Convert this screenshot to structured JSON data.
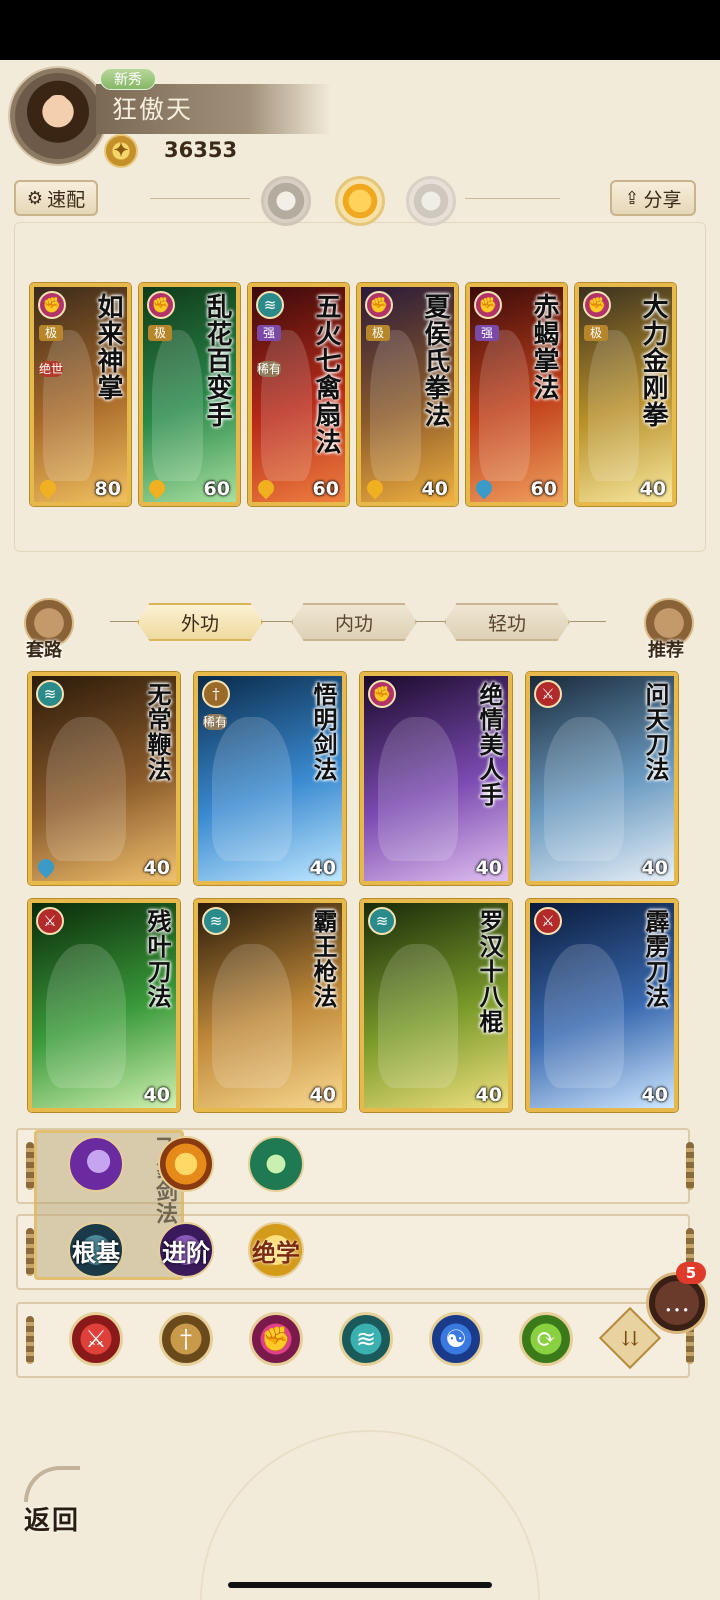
{
  "player": {
    "rank_badge": "新秀",
    "name": "狂傲天",
    "power_icon": "power-medal-icon",
    "power": "36353"
  },
  "toolbar": {
    "quick_equip_label": "速配",
    "quick_equip_icon": "gear-icon",
    "share_label": "分享",
    "share_icon": "share-icon",
    "modes": [
      {
        "icon": "moon-mode-icon",
        "active": false
      },
      {
        "icon": "sun-mode-icon",
        "active": true
      },
      {
        "icon": "ring-mode-icon",
        "active": false
      }
    ]
  },
  "equipped": [
    {
      "title": "如来神掌",
      "type": "fist",
      "tags": [
        "极",
        "绝世"
      ],
      "element": "fire",
      "level": "80",
      "art": [
        "#3a2a1a",
        "#a86a2a",
        "#f0c060"
      ]
    },
    {
      "title": "乱花百变手",
      "type": "fist",
      "tags": [
        "极"
      ],
      "element": "fire",
      "level": "60",
      "art": [
        "#103a1a",
        "#2a8a4a",
        "#a8e0a0"
      ]
    },
    {
      "title": "五火七禽扇法",
      "type": "fan",
      "tags": [
        "强",
        "稀有"
      ],
      "element": "fire",
      "level": "60",
      "art": [
        "#3a0a0a",
        "#b82a1a",
        "#f08040"
      ]
    },
    {
      "title": "夏侯氏拳法",
      "type": "fist",
      "tags": [
        "极"
      ],
      "element": "fire",
      "level": "40",
      "art": [
        "#2a1a3a",
        "#8a5a2a",
        "#f0b040"
      ]
    },
    {
      "title": "赤蝎掌法",
      "type": "fist",
      "tags": [
        "强"
      ],
      "element": "water",
      "level": "60",
      "art": [
        "#3a0a0a",
        "#c0401a",
        "#f0a060"
      ]
    },
    {
      "title": "大力金刚拳",
      "type": "fist",
      "tags": [
        "极"
      ],
      "element": "",
      "level": "40",
      "art": [
        "#3a3020",
        "#b8902a",
        "#f8e8a0"
      ]
    }
  ],
  "tabs": {
    "routines_label": "套路",
    "routines_icon": "scroll-icon",
    "recommend_label": "推荐",
    "recommend_icon": "cards-icon",
    "items": [
      {
        "label": "外功",
        "active": true
      },
      {
        "label": "内功",
        "active": false
      },
      {
        "label": "轻功",
        "active": false
      }
    ]
  },
  "library": [
    {
      "title": "无常鞭法",
      "type": "fan",
      "tags": [],
      "element": "water",
      "level": "40",
      "art": [
        "#2a1a0a",
        "#8a5a2a",
        "#f0c070"
      ]
    },
    {
      "title": "悟明剑法",
      "type": "sword",
      "tags": [
        "稀有"
      ],
      "element": "",
      "level": "40",
      "art": [
        "#0a2a4a",
        "#3a8ad0",
        "#c0e8ff"
      ]
    },
    {
      "title": "绝情美人手",
      "type": "fist",
      "tags": [],
      "element": "",
      "level": "40",
      "art": [
        "#1a0a2a",
        "#7a4ab0",
        "#e0c0f0"
      ]
    },
    {
      "title": "问天刀法",
      "type": "blade",
      "tags": [],
      "element": "",
      "level": "40",
      "art": [
        "#1a2a3a",
        "#6a9ac0",
        "#e8f0f8"
      ]
    },
    {
      "title": "残叶刀法",
      "type": "blade",
      "tags": [],
      "element": "",
      "level": "40",
      "art": [
        "#0a2a0a",
        "#3a9a3a",
        "#d0f0b0"
      ]
    },
    {
      "title": "霸王枪法",
      "type": "fan",
      "tags": [],
      "element": "",
      "level": "40",
      "art": [
        "#2a1a0a",
        "#c08a3a",
        "#f8d890"
      ]
    },
    {
      "title": "罗汉十八棍",
      "type": "fan",
      "tags": [],
      "element": "",
      "level": "40",
      "art": [
        "#1a2a0a",
        "#7a9a2a",
        "#f0e080"
      ]
    },
    {
      "title": "霹雳刀法",
      "type": "blade",
      "tags": [],
      "element": "",
      "level": "40",
      "art": [
        "#0a1a3a",
        "#3a6ab0",
        "#d0e8ff"
      ]
    }
  ],
  "filters": {
    "overlay_title": "飞象剑法",
    "row1_icons": [
      "moon-orb-icon",
      "sun-orb-icon",
      "green-orb-icon"
    ],
    "row2": [
      {
        "label": "根基",
        "icon": "root-orb-icon"
      },
      {
        "label": "进阶",
        "icon": "advanced-orb-icon"
      },
      {
        "label": "绝学",
        "icon": "ultimate-orb-icon"
      }
    ],
    "weapon_types": [
      {
        "icon": "blade-type-icon",
        "glyph": "⚔"
      },
      {
        "icon": "sword-type-icon",
        "glyph": "†"
      },
      {
        "icon": "fist-type-icon",
        "glyph": "✊"
      },
      {
        "icon": "fan-type-icon",
        "glyph": "≋"
      },
      {
        "icon": "yinyang-type-icon",
        "glyph": "☯"
      },
      {
        "icon": "staff-type-icon",
        "glyph": "⟳"
      }
    ],
    "expand_icon": "double-chevron-down-icon"
  },
  "chat": {
    "icon": "chat-bubble-icon",
    "badge": "5"
  },
  "back": {
    "label": "返回",
    "icon": "back-arrow-icon"
  },
  "colors": {
    "background": "#f2ebd9",
    "card_gold": "#e7b84a",
    "badge_red": "#e03a2a"
  }
}
